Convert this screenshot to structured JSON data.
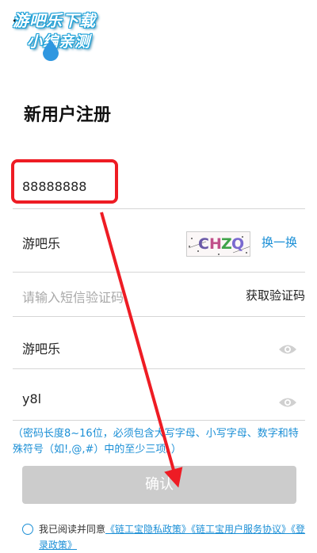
{
  "watermark": {
    "line1": "游吧乐下载",
    "line2": "小编亲测"
  },
  "page": {
    "title": "新用户注册"
  },
  "phone": {
    "value": "88888888"
  },
  "captcha": {
    "input_value": "游吧乐",
    "code_chars": [
      "C",
      "H",
      "Z",
      "Q"
    ],
    "refresh_label": "换一换"
  },
  "sms": {
    "placeholder": "请输入短信验证码",
    "button_label": "获取验证码"
  },
  "password": {
    "value": "游吧乐"
  },
  "confirm_password": {
    "value": "y8l"
  },
  "hint": "（密码长度8~16位，必须包含大写字母、小写字母、数字和特殊符号（如!,@,#）中的至少三项。）",
  "confirm_button": {
    "label": "确认"
  },
  "agreement": {
    "prefix": "我已阅读并同意",
    "privacy_link": "《链工宝隐私政策》",
    "service_link": "《链工宝用户服务协议》",
    "login_link": "《登录政策》"
  },
  "colors": {
    "accent": "#1b8fd6",
    "highlight": "#ee1c24",
    "disabled_button": "#cccccc"
  },
  "icons": {
    "back": "chevron-left-icon",
    "eye": "eye-icon",
    "drop": "water-drop-icon"
  }
}
